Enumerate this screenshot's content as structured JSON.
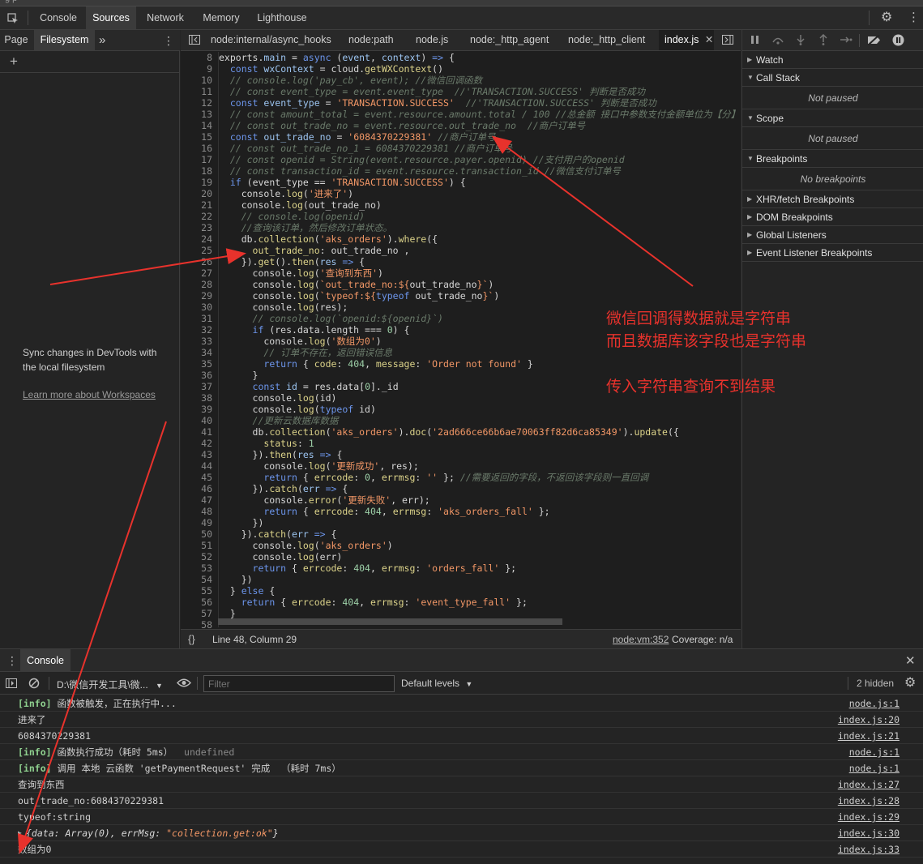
{
  "title_strip": "g            p",
  "main_tabs": [
    "Console",
    "Sources",
    "Network",
    "Memory",
    "Lighthouse"
  ],
  "main_active": "Sources",
  "navigator": {
    "tabs": [
      "Page",
      "Filesystem"
    ],
    "active": "Filesystem",
    "more": "»",
    "add": "+",
    "sync_text": "Sync changes in DevTools with the local filesystem",
    "learn_link": "Learn more about Workspaces"
  },
  "file_tabs": [
    "node:internal/async_hooks",
    "node:path",
    "node.js",
    "node:_http_agent",
    "node:_http_client",
    "index.js"
  ],
  "active_file": "index.js",
  "line_numbers": [
    "8",
    "9",
    "10",
    "11",
    "12",
    "13",
    "14",
    "15",
    "16",
    "17",
    "18",
    "19",
    "20",
    "21",
    "22",
    "23",
    "24",
    "25",
    "26",
    "27",
    "28",
    "29",
    "30",
    "31",
    "32",
    "33",
    "34",
    "35",
    "36",
    "37",
    "38",
    "39",
    "40",
    "41",
    "42",
    "43",
    "44",
    "45",
    "46",
    "47",
    "48",
    "49",
    "50",
    "51",
    "52",
    "53",
    "54",
    "55",
    "56",
    "57",
    "58"
  ],
  "status": {
    "position": "Line 48, Column 29",
    "source_link": "node:vm:352",
    "coverage": "Coverage: n/a",
    "braces": "{}"
  },
  "debugger": {
    "watch": "Watch",
    "call_stack": "Call Stack",
    "call_stack_empty": "Not paused",
    "scope": "Scope",
    "scope_empty": "Not paused",
    "breakpoints": "Breakpoints",
    "breakpoints_empty": "No breakpoints",
    "xhr": "XHR/fetch Breakpoints",
    "dom": "DOM Breakpoints",
    "global": "Global Listeners",
    "event": "Event Listener Breakpoints"
  },
  "console": {
    "drawer_tab": "Console",
    "context": "D:\\微信开发工具\\微...",
    "filter_placeholder": "Filter",
    "levels": "Default levels",
    "hidden": "2 hidden",
    "rows": [
      {
        "tag": "[info]",
        "text": " 函数被触发，正在执行中...",
        "extra": "",
        "src": "node.js:1"
      },
      {
        "tag": "",
        "text": "进来了",
        "extra": "",
        "src": "index.js:20"
      },
      {
        "tag": "",
        "text": "6084370229381",
        "extra": "",
        "src": "index.js:21"
      },
      {
        "tag": "[info]",
        "text": " 函数执行成功（耗时 5ms）",
        "extra": "  undefined",
        "src": "node.js:1"
      },
      {
        "tag": "[info]",
        "text": " 调用 本地 云函数 'getPaymentRequest' 完成  （耗时 7ms）",
        "extra": "",
        "src": "node.js:1"
      },
      {
        "tag": "",
        "text": "查询到东西",
        "extra": "",
        "src": "index.js:27"
      },
      {
        "tag": "",
        "text": "out_trade_no:6084370229381",
        "extra": "",
        "src": "index.js:28"
      },
      {
        "tag": "",
        "text": "typeof:string",
        "extra": "",
        "src": "index.js:29"
      },
      {
        "tag": "",
        "text": "",
        "extra": "",
        "src": "index.js:30",
        "object": true,
        "obj_a": "{data: Array(0), errMsg: ",
        "obj_b": "\"collection.get:ok\"",
        "obj_c": "}"
      },
      {
        "tag": "",
        "text": "数组为0",
        "extra": "",
        "src": "index.js:33"
      }
    ]
  },
  "annotations": {
    "line1": "微信回调得数据就是字符串",
    "line2": "而且数据库该字段也是字符串",
    "line3": "传入字符串查询不到结果"
  },
  "colors": {
    "annotation": "#e8322c",
    "keyword": "#6c95eb",
    "string": "#f29766",
    "comment": "#6a7a6a",
    "info": "#8fd18f"
  }
}
